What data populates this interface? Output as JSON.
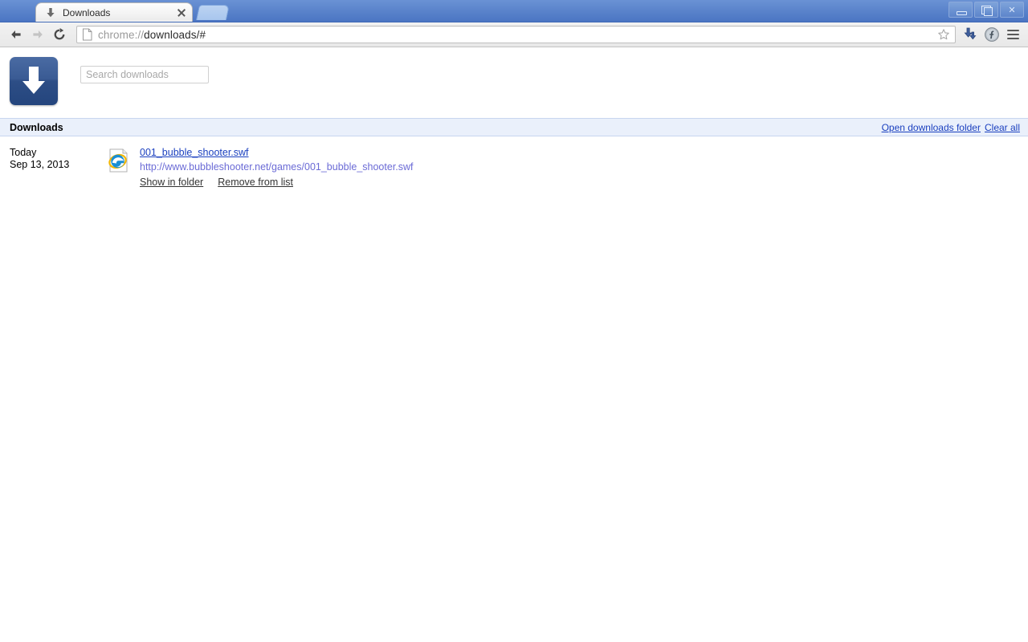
{
  "window": {
    "controls": [
      {
        "name": "minimize",
        "label": "–"
      },
      {
        "name": "maximize",
        "label": "❐"
      },
      {
        "name": "close",
        "label": "✕"
      }
    ]
  },
  "tabstrip": {
    "tabs": [
      {
        "title": "Downloads",
        "favicon": "download-arrow-icon",
        "close_label": "×"
      }
    ],
    "new_tab_label": "+"
  },
  "toolbar": {
    "back_icon": "back-arrow-icon",
    "forward_icon": "forward-arrow-icon",
    "reload_icon": "reload-icon",
    "omnibox": {
      "page_icon": "page-icon",
      "scheme": "chrome://",
      "rest": "downloads/#",
      "full_url": "chrome://downloads/#",
      "star_icon": "bookmark-star-icon"
    },
    "actions": [
      {
        "name": "downloads-toolbar-icon",
        "label": "downloads-icon"
      },
      {
        "name": "flash-plugin-icon",
        "label": "flash-icon"
      },
      {
        "name": "chrome-menu-icon",
        "label": "menu-icon"
      }
    ]
  },
  "page": {
    "logo_icon": "downloads-logo-icon",
    "search": {
      "placeholder": "Search downloads",
      "value": ""
    },
    "section": {
      "title": "Downloads",
      "open_folder_label": "Open downloads folder",
      "clear_all_label": "Clear all"
    },
    "downloads": [
      {
        "date_day": "Today",
        "date_full": "Sep 13, 2013",
        "file_icon": "internet-explorer-file-icon",
        "filename": "001_bubble_shooter.swf",
        "url": "http://www.bubbleshooter.net/games/001_bubble_shooter.swf",
        "show_in_folder_label": "Show in folder",
        "remove_from_list_label": "Remove from list"
      }
    ]
  },
  "colors": {
    "tabstrip_blue": "#5a83cb",
    "link_blue": "#1a3fbf",
    "url_purple": "#6b6bd6",
    "section_bg": "#eaf0fb",
    "logo_blue": "#2d4e86"
  }
}
